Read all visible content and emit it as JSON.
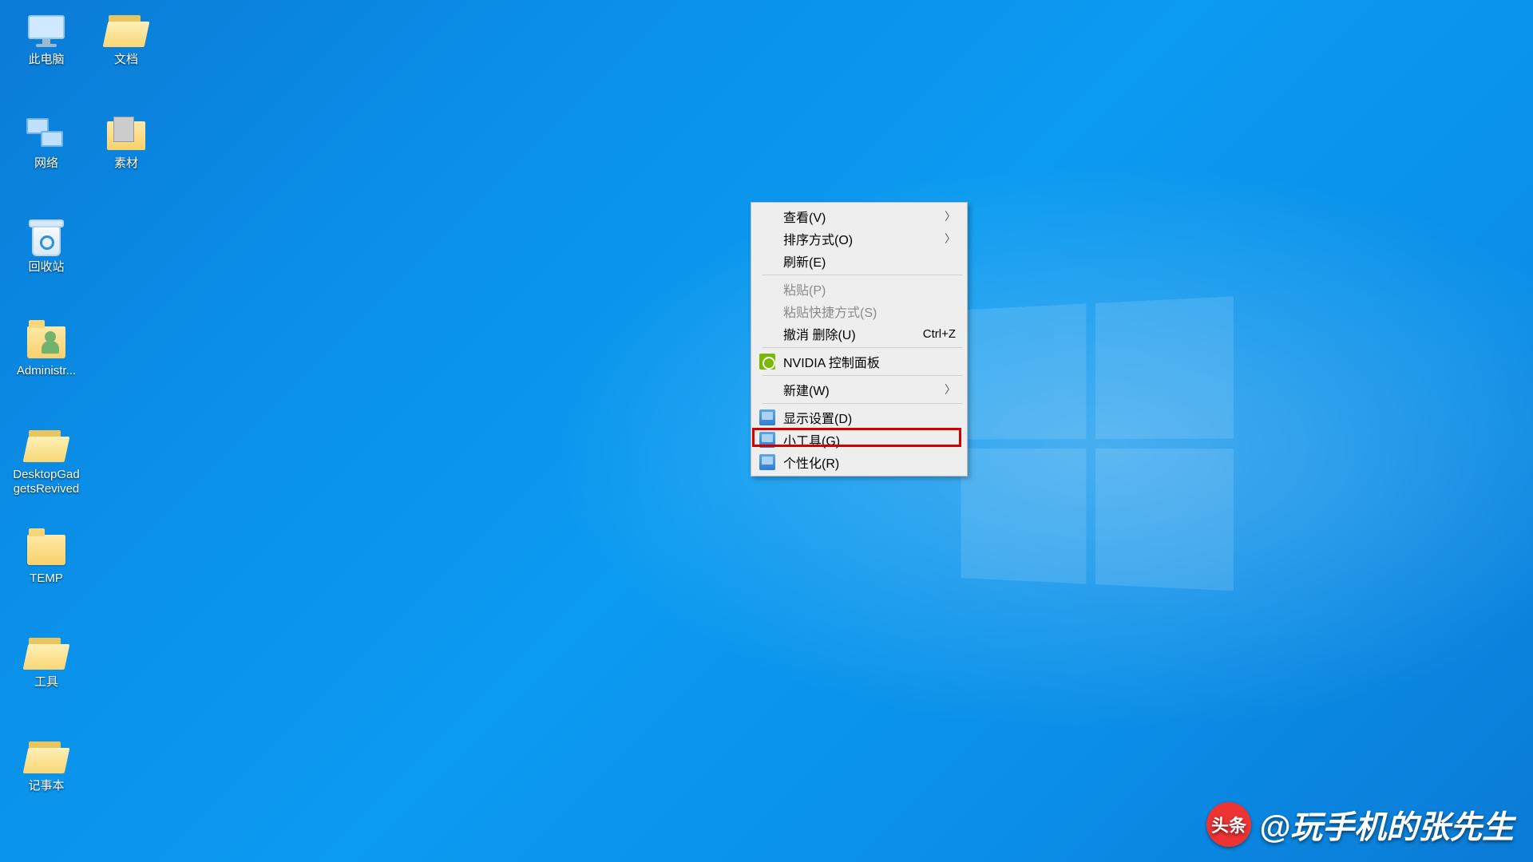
{
  "desktop": {
    "icons": [
      {
        "id": "this-pc",
        "label": "此电脑",
        "kind": "pc",
        "col": 1,
        "row": 1
      },
      {
        "id": "documents",
        "label": "文档",
        "kind": "folder-open",
        "col": 2,
        "row": 1
      },
      {
        "id": "network",
        "label": "网络",
        "kind": "network",
        "col": 1,
        "row": 2
      },
      {
        "id": "materials",
        "label": "素材",
        "kind": "thumb",
        "col": 2,
        "row": 2
      },
      {
        "id": "recycle-bin",
        "label": "回收站",
        "kind": "bin",
        "col": 1,
        "row": 3
      },
      {
        "id": "administrator",
        "label": "Administr...",
        "kind": "user",
        "col": 1,
        "row": 4
      },
      {
        "id": "gadgets",
        "label": "DesktopGad\ngetsRevived",
        "kind": "folder-open",
        "col": 1,
        "row": 5
      },
      {
        "id": "temp",
        "label": "TEMP",
        "kind": "folder",
        "col": 1,
        "row": 6
      },
      {
        "id": "tools",
        "label": "工具",
        "kind": "folder-open",
        "col": 1,
        "row": 7
      },
      {
        "id": "notepad",
        "label": "记事本",
        "kind": "folder-open",
        "col": 1,
        "row": 8
      }
    ]
  },
  "context_menu": {
    "items": [
      {
        "id": "view",
        "label": "查看(V)",
        "submenu": true
      },
      {
        "id": "sort",
        "label": "排序方式(O)",
        "submenu": true
      },
      {
        "id": "refresh",
        "label": "刷新(E)"
      },
      {
        "sep": true
      },
      {
        "id": "paste",
        "label": "粘贴(P)",
        "disabled": true
      },
      {
        "id": "paste-shortcut",
        "label": "粘贴快捷方式(S)",
        "disabled": true
      },
      {
        "id": "undo-delete",
        "label": "撤消 删除(U)",
        "shortcut": "Ctrl+Z"
      },
      {
        "sep": true
      },
      {
        "id": "nvidia",
        "label": "NVIDIA 控制面板",
        "icon": "nvidia"
      },
      {
        "sep": true
      },
      {
        "id": "new",
        "label": "新建(W)",
        "submenu": true
      },
      {
        "sep": true
      },
      {
        "id": "display",
        "label": "显示设置(D)",
        "icon": "blue-mon"
      },
      {
        "id": "gadgets",
        "label": "小工具(G)",
        "icon": "blue-mon",
        "highlight": true
      },
      {
        "id": "personalize",
        "label": "个性化(R)",
        "icon": "blue-mon"
      }
    ]
  },
  "watermark": {
    "logo_text": "头条",
    "text": "@玩手机的张先生"
  }
}
